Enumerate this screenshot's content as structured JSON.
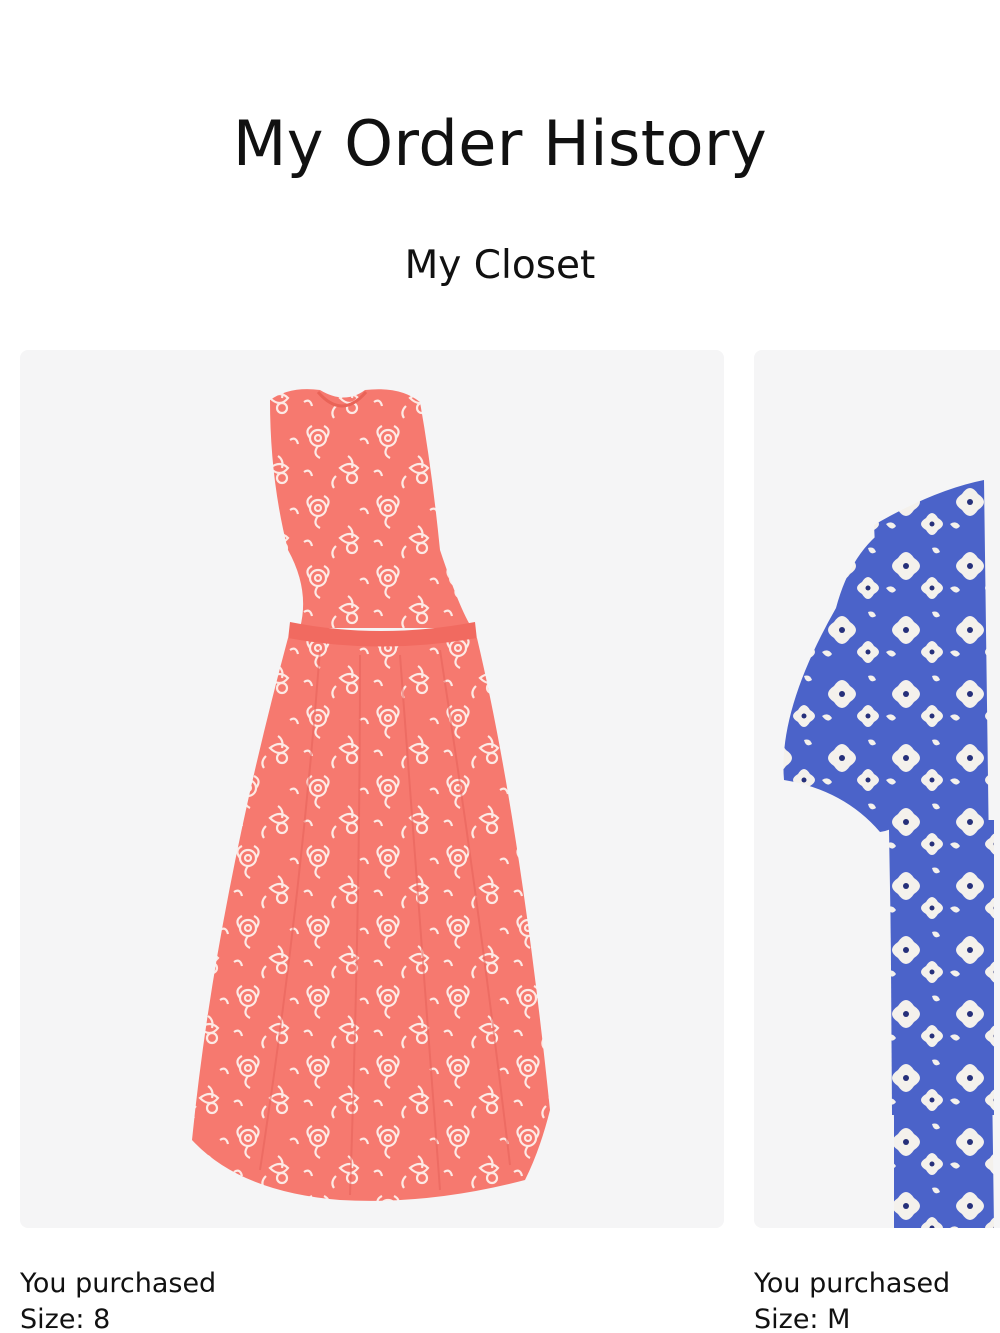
{
  "page": {
    "title": "My Order History"
  },
  "section": {
    "title": "My Closet"
  },
  "products": [
    {
      "image": "pink-floral-sleeveless-midi-dress",
      "image_colors": {
        "base": "#f6796f",
        "pattern": "#fde9e4"
      },
      "purchase_label": "You purchased",
      "size_label": "Size: 8"
    },
    {
      "image": "blue-floral-short-sleeve-top",
      "image_colors": {
        "base": "#4b63c9",
        "pattern": "#f4f1ec"
      },
      "purchase_label": "You purchased",
      "size_label": "Size: M"
    }
  ]
}
